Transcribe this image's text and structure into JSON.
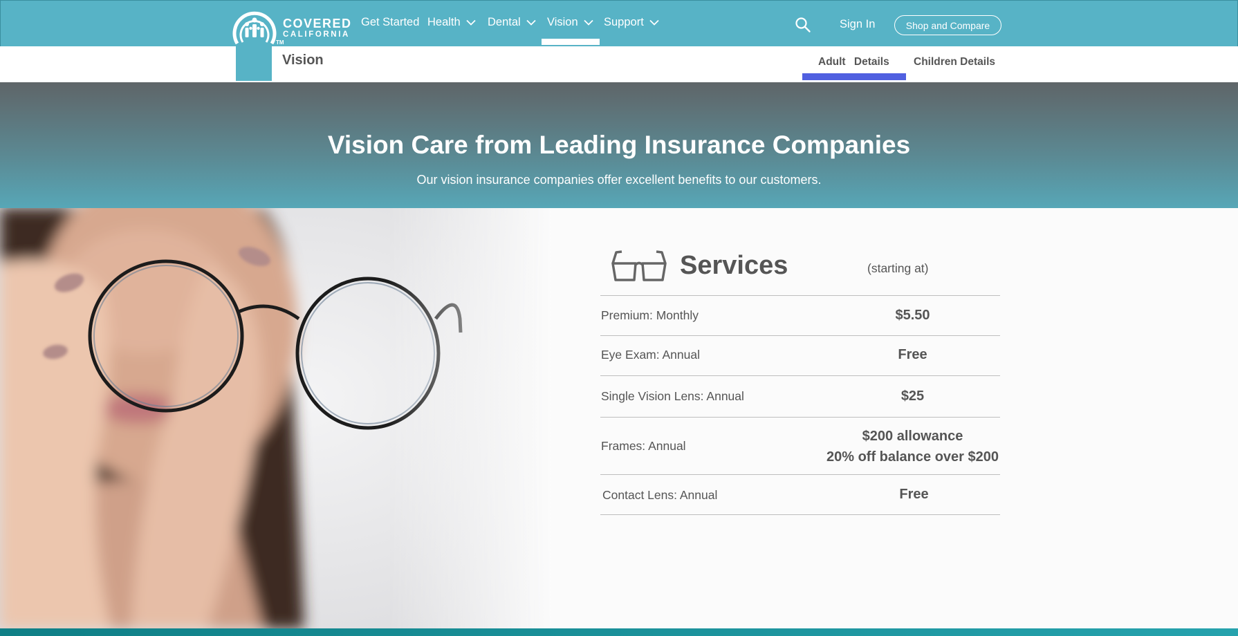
{
  "brand": {
    "line1": "COVERED",
    "line2": "CALIFORNIA",
    "tm": "TM"
  },
  "nav": {
    "items": [
      {
        "label": "Get Started",
        "has_dropdown": false
      },
      {
        "label": "Health",
        "has_dropdown": true
      },
      {
        "label": "Dental",
        "has_dropdown": true
      },
      {
        "label": "Vision",
        "has_dropdown": true,
        "active": true
      },
      {
        "label": "Support",
        "has_dropdown": true
      }
    ],
    "search_icon": "search-icon",
    "sign_in": "Sign In",
    "shop_compare": "Shop and Compare"
  },
  "subnav": {
    "title": "Vision",
    "links": [
      {
        "label": "Adult Details",
        "active": true
      },
      {
        "label": "Children Details",
        "active": false
      }
    ]
  },
  "hero": {
    "title": "Vision Care from Leading Insurance Companies",
    "subtitle": "Our vision insurance companies offer excellent benefits to our customers."
  },
  "services": {
    "icon": "glasses-icon",
    "title": "Services",
    "starting_at": "(starting at)",
    "rows": [
      {
        "label": "Premium: Monthly",
        "value": "$5.50"
      },
      {
        "label": "Eye Exam: Annual",
        "value": "Free"
      },
      {
        "label": "Single Vision Lens: Annual",
        "value": "$25"
      },
      {
        "label": "Frames: Annual",
        "value": "$200 allowance",
        "value2": "20% off balance over $200"
      },
      {
        "label": "Contact Lens: Annual",
        "value": "Free"
      }
    ]
  },
  "colors": {
    "nav_bg": "#57b3c6",
    "active_underline": "#5060e0",
    "text_gray": "#555555",
    "footer_teal": "#0f7f86"
  }
}
